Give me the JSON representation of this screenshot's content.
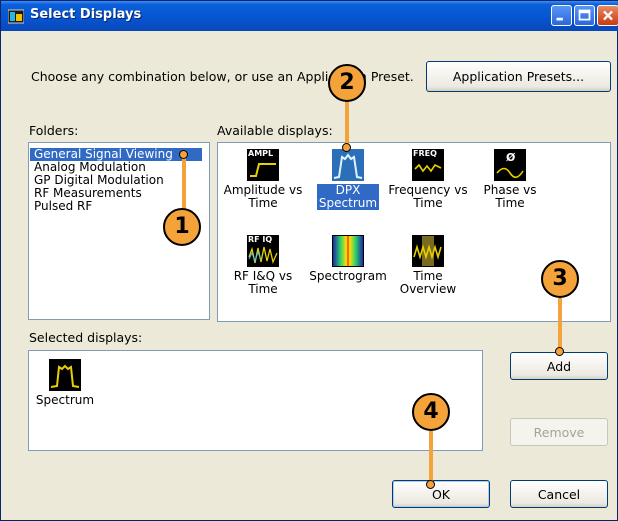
{
  "window": {
    "title": "Select Displays"
  },
  "instruction": "Choose any combination below, or use an Application Preset.",
  "buttons": {
    "presets": "Application Presets...",
    "add": "Add",
    "remove": "Remove",
    "ok": "OK",
    "cancel": "Cancel"
  },
  "folders": {
    "label": "Folders:",
    "items": [
      {
        "label": "General Signal Viewing",
        "selected": true
      },
      {
        "label": "Analog Modulation",
        "selected": false
      },
      {
        "label": "GP Digital Modulation",
        "selected": false
      },
      {
        "label": "RF Measurements",
        "selected": false
      },
      {
        "label": "Pulsed RF",
        "selected": false
      }
    ]
  },
  "available": {
    "label": "Available displays:",
    "items": [
      {
        "caption": "Amplitude vs Time",
        "icon": "amplitude-vs-time-icon",
        "icon_text": "AMPL",
        "selected": false
      },
      {
        "caption": "DPX Spectrum",
        "icon": "dpx-spectrum-icon",
        "icon_text": "",
        "selected": true
      },
      {
        "caption": "Frequency vs Time",
        "icon": "frequency-vs-time-icon",
        "icon_text": "FREQ",
        "selected": false
      },
      {
        "caption": "Phase vs Time",
        "icon": "phase-vs-time-icon",
        "icon_text": "Ø",
        "selected": false
      },
      {
        "caption": "RF I&Q vs Time",
        "icon": "rf-iq-vs-time-icon",
        "icon_text": "RF IQ",
        "selected": false
      },
      {
        "caption": "Spectrogram",
        "icon": "spectrogram-icon",
        "icon_text": "",
        "selected": false
      },
      {
        "caption": "Time Overview",
        "icon": "time-overview-icon",
        "icon_text": "",
        "selected": false
      }
    ]
  },
  "selected_displays": {
    "label": "Selected displays:",
    "items": [
      {
        "caption": "Spectrum",
        "icon": "spectrum-icon"
      }
    ]
  },
  "callouts": [
    "1",
    "2",
    "3",
    "4"
  ],
  "colors": {
    "titlebar": "#0654d0",
    "selection": "#316ac5",
    "callout": "#f4a23a",
    "dialog_bg": "#ece9d8"
  }
}
